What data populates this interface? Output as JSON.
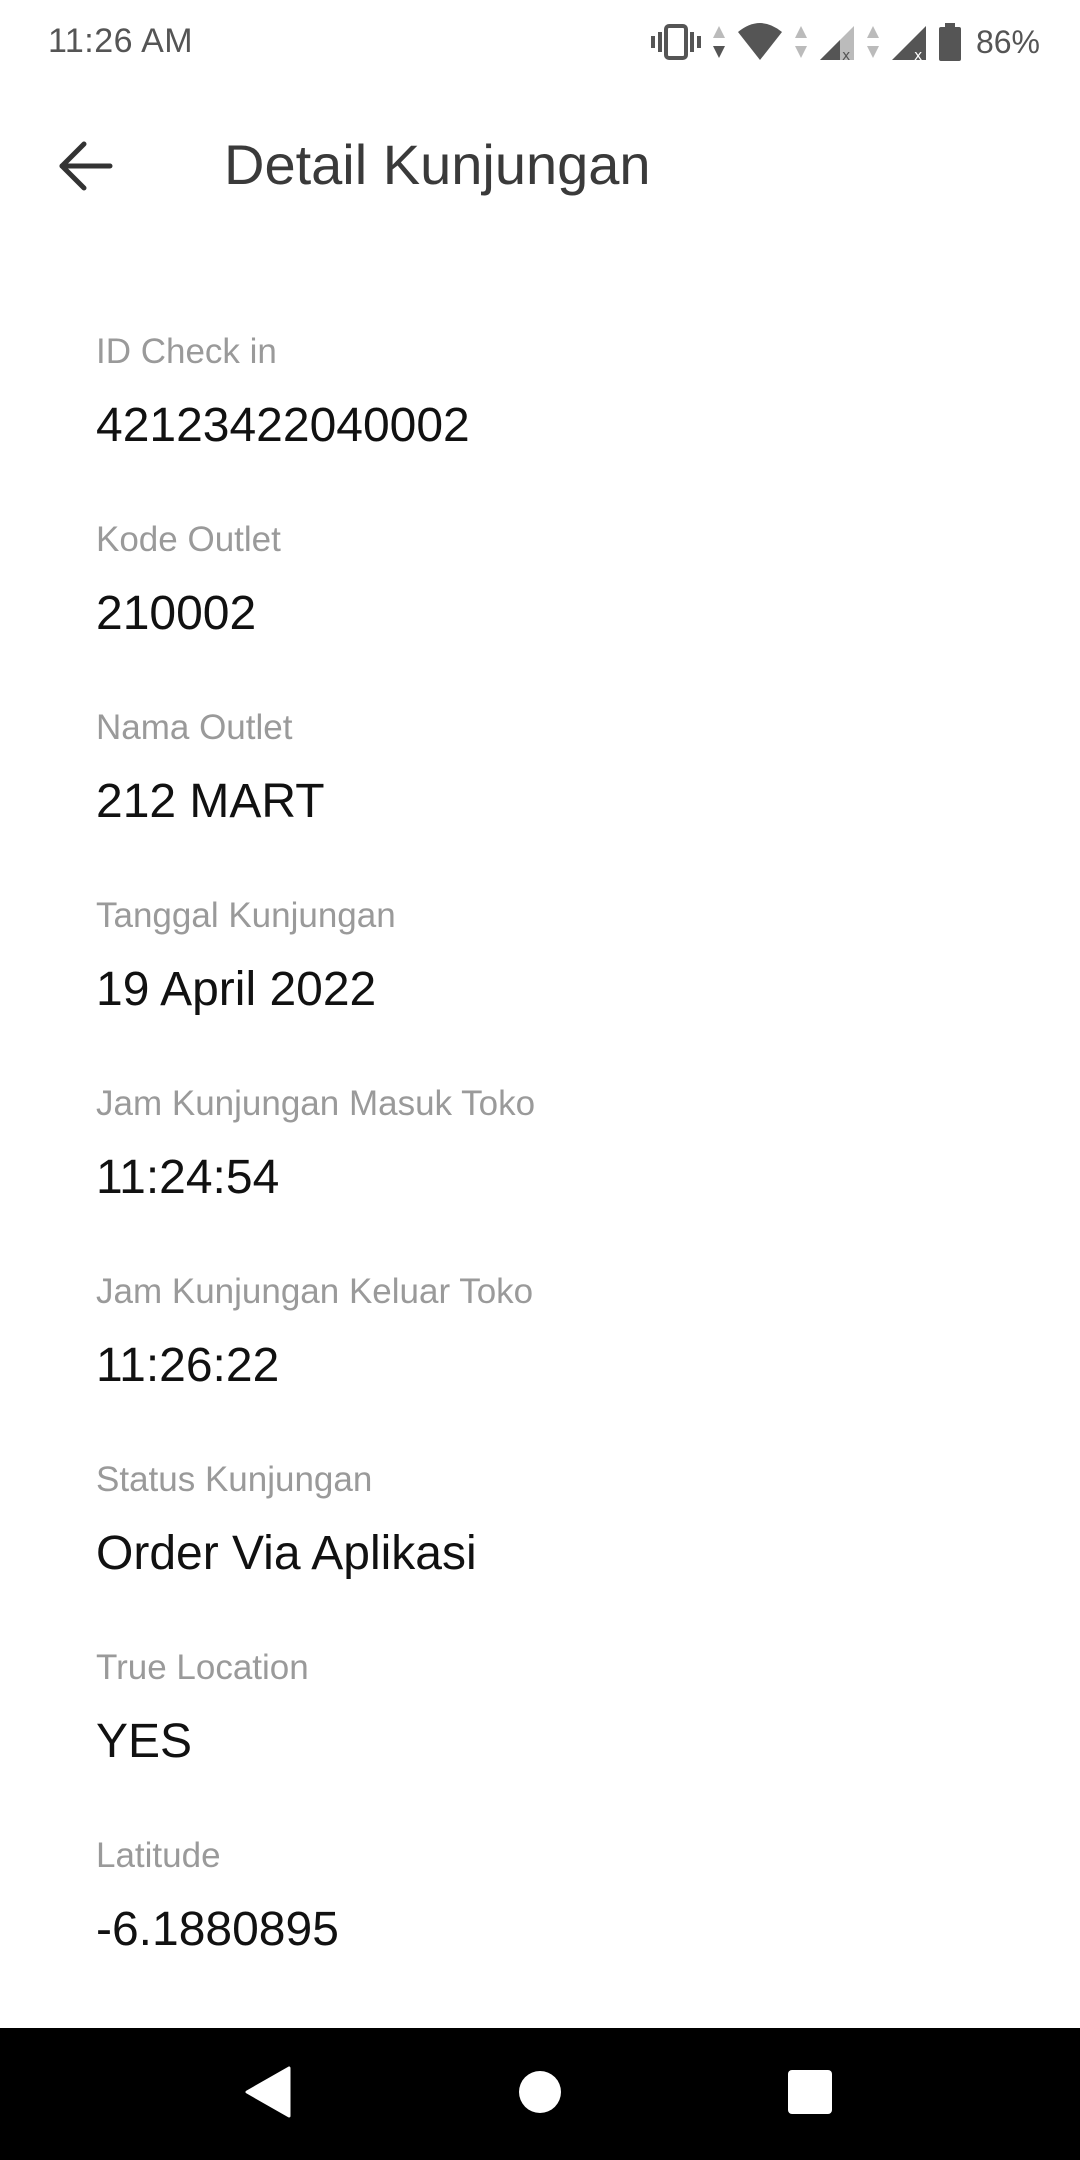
{
  "status_bar": {
    "time": "11:26 AM",
    "battery_percent": "86%",
    "icons": [
      "vibrate-icon",
      "data-arrows-icon",
      "wifi-icon",
      "data-arrows-icon",
      "signal-no-service-icon",
      "data-arrows-icon",
      "signal-no-service-icon",
      "battery-icon"
    ]
  },
  "header": {
    "title": "Detail Kunjungan",
    "back_icon": "arrow-back-icon"
  },
  "details": [
    {
      "label": "ID Check in",
      "value": "42123422040002"
    },
    {
      "label": "Kode Outlet",
      "value": "210002"
    },
    {
      "label": "Nama Outlet",
      "value": "212 MART"
    },
    {
      "label": "Tanggal Kunjungan",
      "value": "19 April 2022"
    },
    {
      "label": "Jam Kunjungan Masuk Toko",
      "value": "11:24:54"
    },
    {
      "label": "Jam Kunjungan Keluar Toko",
      "value": "11:26:22"
    },
    {
      "label": "Status Kunjungan",
      "value": "Order Via Aplikasi"
    },
    {
      "label": "True Location",
      "value": "YES"
    },
    {
      "label": "Latitude",
      "value": "-6.1880895"
    }
  ],
  "nav_bar": {
    "buttons": [
      "back-triangle-icon",
      "home-circle-icon",
      "recents-square-icon"
    ]
  },
  "colors": {
    "label": "#9a9a9a",
    "value": "#111111",
    "title": "#3a3a3a",
    "nav_background": "#000000",
    "nav_icon": "#ffffff"
  }
}
